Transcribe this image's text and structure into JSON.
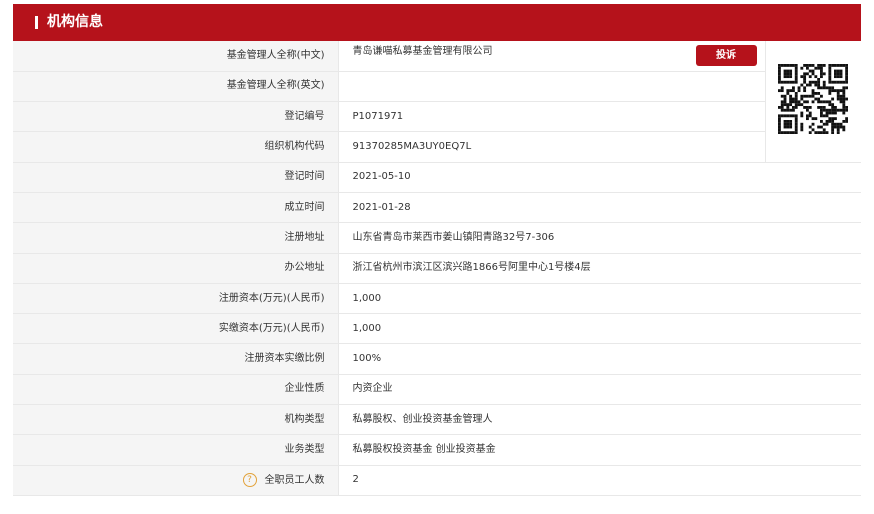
{
  "header": {
    "title": "机构信息"
  },
  "complain_label": "投诉",
  "employee_label": "全职员工人数",
  "employee_value": "2",
  "rows": [
    {
      "label": "基金管理人全称(中文)",
      "value": "青岛谦喵私募基金管理有限公司"
    },
    {
      "label": "基金管理人全称(英文)",
      "value": ""
    },
    {
      "label": "登记编号",
      "value": "P1071971"
    },
    {
      "label": "组织机构代码",
      "value": "91370285MA3UY0EQ7L"
    },
    {
      "label": "登记时间",
      "value": "2021-05-10"
    },
    {
      "label": "成立时间",
      "value": "2021-01-28"
    },
    {
      "label": "注册地址",
      "value": "山东省青岛市莱西市姜山镇阳青路32号7-306"
    },
    {
      "label": "办公地址",
      "value": "浙江省杭州市滨江区滨兴路1866号阿里中心1号楼4层"
    },
    {
      "label": "注册资本(万元)(人民币)",
      "value": "1,000"
    },
    {
      "label": "实缴资本(万元)(人民币)",
      "value": "1,000"
    },
    {
      "label": "注册资本实缴比例",
      "value": "100%"
    },
    {
      "label": "企业性质",
      "value": "内资企业"
    },
    {
      "label": "机构类型",
      "value": "私募股权、创业投资基金管理人"
    },
    {
      "label": "业务类型",
      "value": "私募股权投资基金  创业投资基金"
    }
  ]
}
